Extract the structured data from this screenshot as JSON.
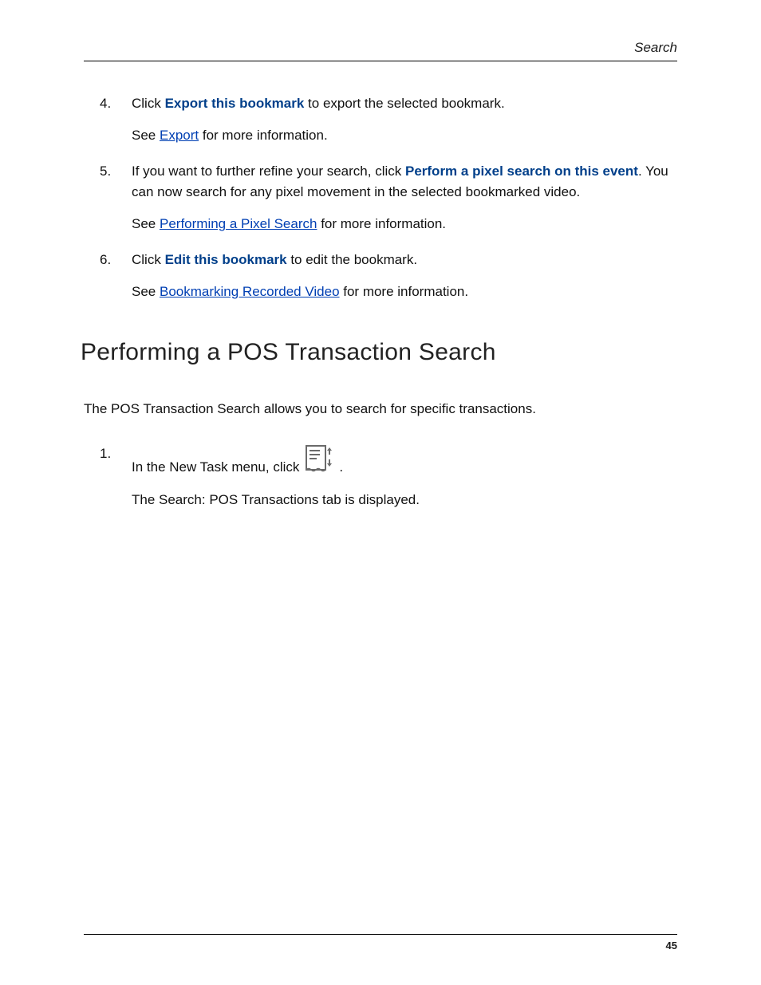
{
  "header": {
    "section": "Search"
  },
  "steps_top": [
    {
      "num": "4.",
      "prefix": "Click ",
      "bold": "Export this bookmark",
      "suffix": " to export the selected bookmark.",
      "see_prefix": "See ",
      "see_link": "Export",
      "see_suffix": " for more information."
    },
    {
      "num": "5.",
      "prefix": "If you want to further refine your search, click ",
      "bold": "Perform a pixel search on this event",
      "suffix": ". You can now search for any pixel movement in the selected bookmarked video.",
      "see_prefix": "See ",
      "see_link": "Performing a Pixel Search",
      "see_suffix": " for more information."
    },
    {
      "num": "6.",
      "prefix": "Click ",
      "bold": "Edit this bookmark",
      "suffix": " to edit the bookmark.",
      "see_prefix": "See ",
      "see_link": "Bookmarking Recorded Video",
      "see_suffix": " for more information."
    }
  ],
  "section_title": "Performing a POS Transaction Search",
  "intro": "The POS Transaction Search allows you to search for specific transactions.",
  "steps_bottom": [
    {
      "num": "1.",
      "prefix": "In the New Task menu, click ",
      "icon": "pos-search-icon",
      "suffix": " .",
      "follow": "The Search: POS Transactions tab is displayed."
    }
  ],
  "footer": {
    "page": "45"
  }
}
